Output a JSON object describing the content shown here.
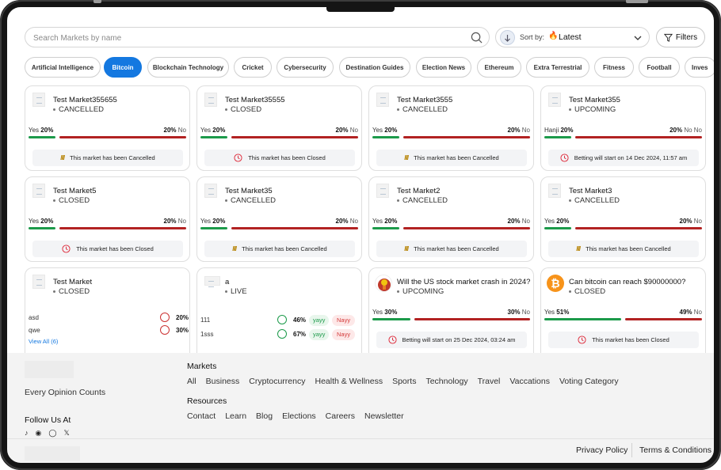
{
  "search": {
    "placeholder": "Search Markets by name"
  },
  "sort": {
    "label": "Sort by:",
    "value": "Latest"
  },
  "filters": {
    "label": "Filters"
  },
  "categories": [
    {
      "label": "Artificial Intelligence"
    },
    {
      "label": "Bitcoin",
      "active": true
    },
    {
      "label": "Blockchain Technology"
    },
    {
      "label": "Cricket"
    },
    {
      "label": "Cybersecurity"
    },
    {
      "label": "Destination Guides"
    },
    {
      "label": "Election News"
    },
    {
      "label": "Ethereum"
    },
    {
      "label": "Extra Terrestrial"
    },
    {
      "label": "Fitness"
    },
    {
      "label": "Football"
    },
    {
      "label": "Inves"
    }
  ],
  "cards": [
    {
      "title": "Test Market355655",
      "status": "CANCELLED",
      "yes_label": "Yes",
      "yes_pct": "20%",
      "no_pct": "20%",
      "no_label": "No",
      "notice": "This market has been Cancelled"
    },
    {
      "title": "Test Market35555",
      "status": "CLOSED",
      "yes_label": "Yes",
      "yes_pct": "20%",
      "no_pct": "20%",
      "no_label": "No",
      "notice": "This market has been Closed"
    },
    {
      "title": "Test Market3555",
      "status": "CANCELLED",
      "yes_label": "Yes",
      "yes_pct": "20%",
      "no_pct": "20%",
      "no_label": "No",
      "notice": "This market has been Cancelled"
    },
    {
      "title": "Test Market355",
      "status": "UPCOMING",
      "yes_label": "Hanji",
      "yes_pct": "20%",
      "no_pct": "20%",
      "no_label": "No No",
      "notice": "Betting will start on 14 Dec 2024, 11:57 am"
    },
    {
      "title": "Test Market5",
      "status": "CLOSED",
      "yes_label": "Yes",
      "yes_pct": "20%",
      "no_pct": "20%",
      "no_label": "No",
      "notice": "This market has been Closed"
    },
    {
      "title": "Test Market35",
      "status": "CANCELLED",
      "yes_label": "Yes",
      "yes_pct": "20%",
      "no_pct": "20%",
      "no_label": "No",
      "notice": "This market has been Cancelled"
    },
    {
      "title": "Test Market2",
      "status": "CANCELLED",
      "yes_label": "Yes",
      "yes_pct": "20%",
      "no_pct": "20%",
      "no_label": "No",
      "notice": "This market has been Cancelled"
    },
    {
      "title": "Test Market3",
      "status": "CANCELLED",
      "yes_label": "Yes",
      "yes_pct": "20%",
      "no_pct": "20%",
      "no_label": "No",
      "notice": "This market has been Cancelled"
    }
  ],
  "multi_card": {
    "title": "Test Market",
    "status": "CLOSED",
    "options": [
      {
        "name": "asd",
        "pct": "20%"
      },
      {
        "name": "qwe",
        "pct": "30%"
      }
    ],
    "view_all": "View All (6)"
  },
  "live_card": {
    "title": "a",
    "status": "LIVE",
    "options": [
      {
        "name": "111",
        "pct": "46%",
        "yes": "yayy",
        "no": "Nayy"
      },
      {
        "name": "1sss",
        "pct": "67%",
        "yes": "yayy",
        "no": "Nayy"
      }
    ]
  },
  "crash_card": {
    "title": "Will the US stock market crash in 2024?",
    "status": "UPCOMING",
    "yes_label": "Yes",
    "yes_pct": "30%",
    "no_pct": "30%",
    "no_label": "No",
    "notice": "Betting will start on 25 Dec 2024, 03:24 am"
  },
  "bitcoin_card": {
    "title": "Can bitcoin can reach $90000000?",
    "status": "CLOSED",
    "yes_label": "Yes",
    "yes_pct": "51%",
    "no_pct": "49%",
    "no_label": "No",
    "notice": "This market has been Closed"
  },
  "footer": {
    "tagline": "Every Opinion Counts",
    "follow_title": "Follow Us At",
    "markets_heading": "Markets",
    "markets_links": [
      "All",
      "Business",
      "Cryptocurrency",
      "Health & Wellness",
      "Sports",
      "Technology",
      "Travel",
      "Vaccations",
      "Voting Category"
    ],
    "resources_heading": "Resources",
    "resources_links": [
      "Contact",
      "Learn",
      "Blog",
      "Elections",
      "Careers",
      "Newsletter"
    ],
    "privacy": "Privacy Policy",
    "terms": "Terms & Conditions"
  },
  "colors": {
    "accent": "#1478e0",
    "yes_bar": "#1c9a4a",
    "no_bar": "#b22222",
    "notice_bg": "#f3f4f6"
  },
  "icons": {
    "search": "search-icon",
    "sort": "arrow-down-icon",
    "flame": "flame-icon",
    "filters": "funnel-icon",
    "clock": "clock-icon",
    "ban": "ban-icon"
  }
}
